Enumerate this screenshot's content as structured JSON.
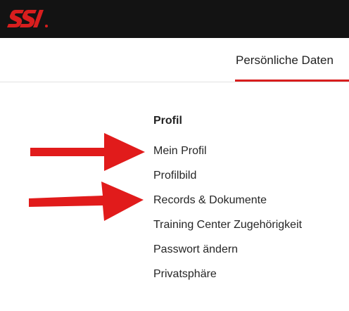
{
  "header": {
    "logo_icon": "ssi-logo",
    "logo_text": "SSI",
    "background_color": "#131313",
    "logo_color": "#d81e1e"
  },
  "tabs": {
    "active_label": "Persönliche Daten",
    "accent_color": "#d81e1e"
  },
  "profile_menu": {
    "heading": "Profil",
    "items": [
      {
        "label": "Mein Profil"
      },
      {
        "label": "Profilbild"
      },
      {
        "label": "Records & Dokumente"
      },
      {
        "label": "Training Center Zugehörigkeit"
      },
      {
        "label": "Passwort ändern"
      },
      {
        "label": "Privatsphäre"
      }
    ]
  },
  "annotations": {
    "arrow_icon": "red-arrow-icon",
    "arrow_color": "#e11b1b",
    "arrow_targets": [
      "Mein Profil",
      "Records & Dokumente"
    ]
  }
}
